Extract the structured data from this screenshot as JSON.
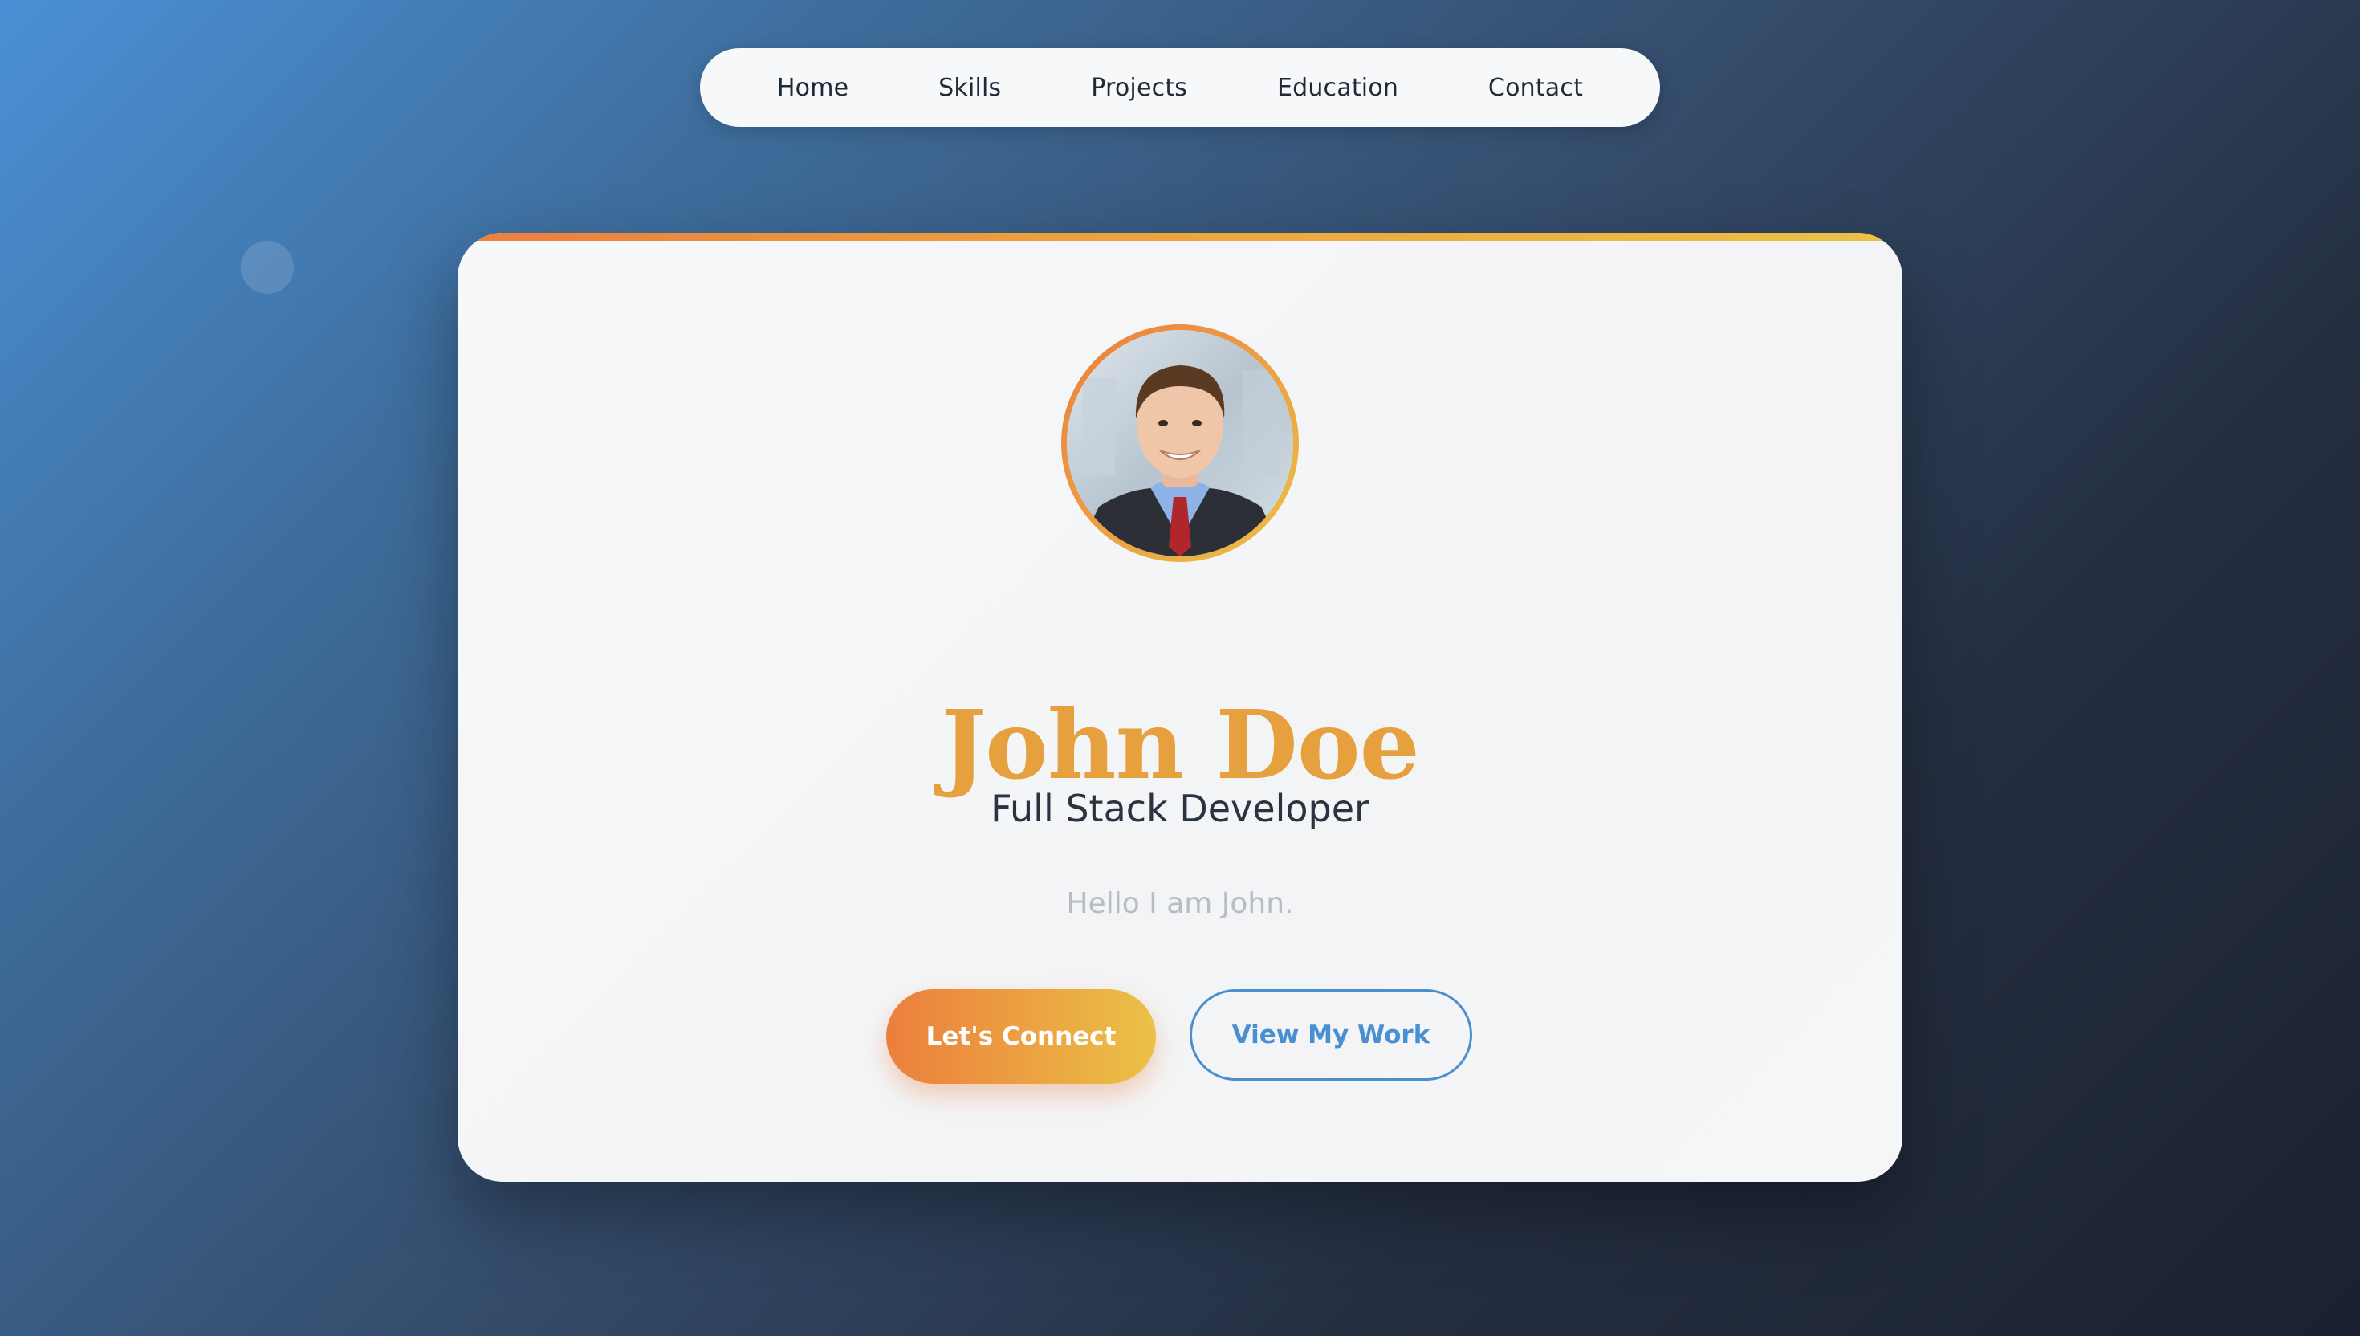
{
  "nav": {
    "items": [
      {
        "label": "Home"
      },
      {
        "label": "Skills"
      },
      {
        "label": "Projects"
      },
      {
        "label": "Education"
      },
      {
        "label": "Contact"
      }
    ]
  },
  "profile": {
    "name": "John Doe",
    "role": "Full Stack Developer",
    "bio": "Hello I am John.",
    "avatar_icon": "profile-photo"
  },
  "actions": {
    "primary_label": "Let's Connect",
    "secondary_label": "View My Work"
  },
  "colors": {
    "accent_orange": "#ec7e3d",
    "accent_yellow": "#ebc146",
    "name_color": "#e7a03e",
    "link_blue": "#4a8fd0",
    "background_start": "#4a90d6",
    "background_end": "#1a2130"
  }
}
